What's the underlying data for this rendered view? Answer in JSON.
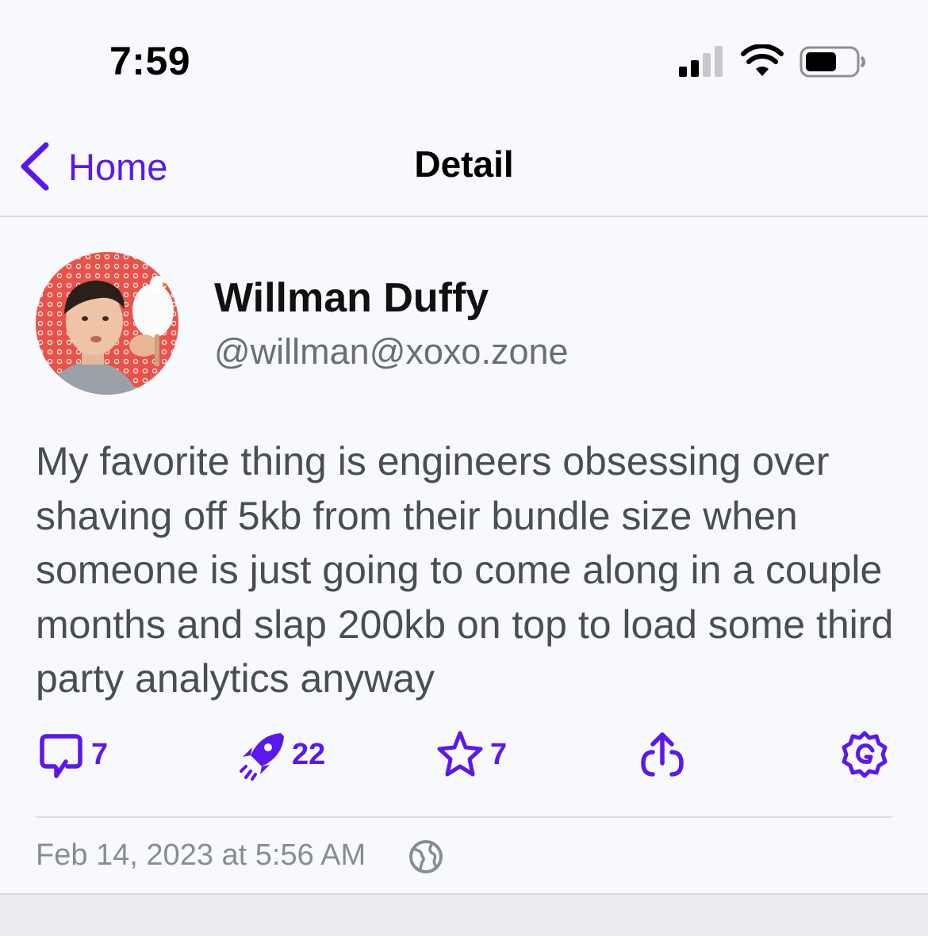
{
  "status_bar": {
    "time": "7:59"
  },
  "nav": {
    "back_label": "Home",
    "title": "Detail"
  },
  "post": {
    "author_name": "Willman Duffy",
    "author_handle": "@willman@xoxo.zone",
    "body": "My favorite thing is engineers obsessing over shaving off 5kb from their bundle size when someone is just going to come along in a couple months and slap 200kb on top to load some third party analytics anyway",
    "actions": {
      "replies": "7",
      "boosts": "22",
      "favorites": "7"
    },
    "date": "Feb 14, 2023 at 5:56 AM"
  },
  "colors": {
    "accent": "#5a18ee",
    "background": "#f8f9fd",
    "body_text": "#4b4d55",
    "secondary_text": "#6b6e76"
  },
  "icons": {
    "reply": "reply-icon",
    "boost": "rocket-icon",
    "favorite": "star-icon",
    "share": "share-icon",
    "more": "gear-icon",
    "visibility": "globe-icon"
  }
}
